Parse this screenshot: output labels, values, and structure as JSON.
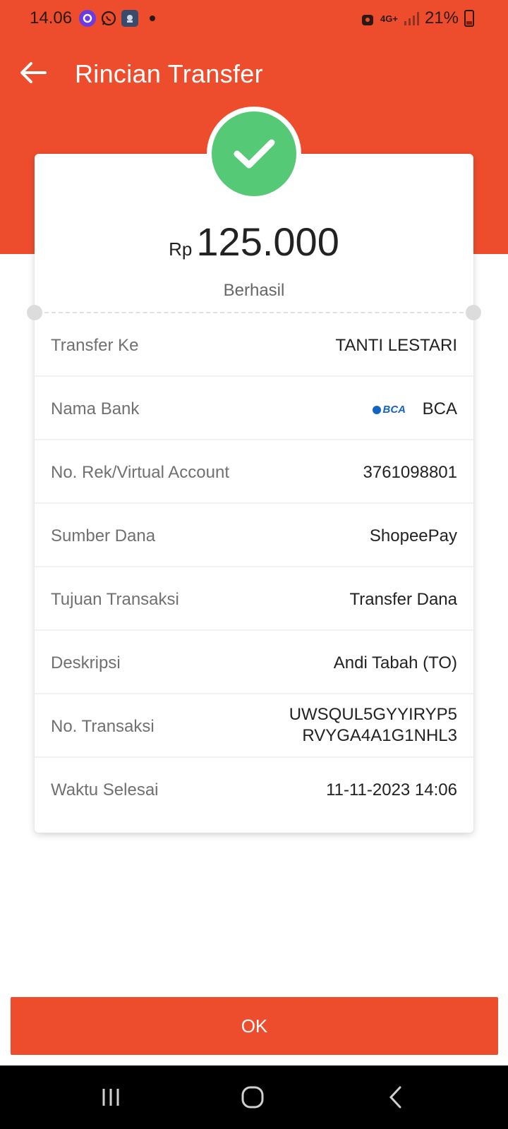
{
  "status_bar": {
    "time": "14.06",
    "network": "4G+",
    "battery": "21%"
  },
  "app_bar": {
    "title": "Rincian Transfer"
  },
  "summary": {
    "currency": "Rp",
    "amount": "125.000",
    "status": "Berhasil"
  },
  "details": [
    {
      "label": "Transfer Ke",
      "value": "TANTI LESTARI"
    },
    {
      "label": "Nama Bank",
      "value": "BCA",
      "logo": "BCA"
    },
    {
      "label": "No. Rek/Virtual Account",
      "value": "3761098801"
    },
    {
      "label": "Sumber Dana",
      "value": "ShopeePay"
    },
    {
      "label": "Tujuan Transaksi",
      "value": "Transfer Dana"
    },
    {
      "label": "Deskripsi",
      "value": "Andi Tabah (TO)"
    },
    {
      "label": "No. Transaksi",
      "value_line1": "UWSQUL5GYYIRYP5",
      "value_line2": "RVYGA4A1G1NHL3"
    },
    {
      "label": "Waktu Selesai",
      "value": "11-11-2023 14:06"
    }
  ],
  "actions": {
    "ok_label": "OK"
  },
  "colors": {
    "brand": "#EE4D2D",
    "success": "#55C975"
  },
  "icons": [
    "back-arrow-icon",
    "check-icon",
    "recents-icon",
    "home-icon",
    "back-nav-icon"
  ]
}
